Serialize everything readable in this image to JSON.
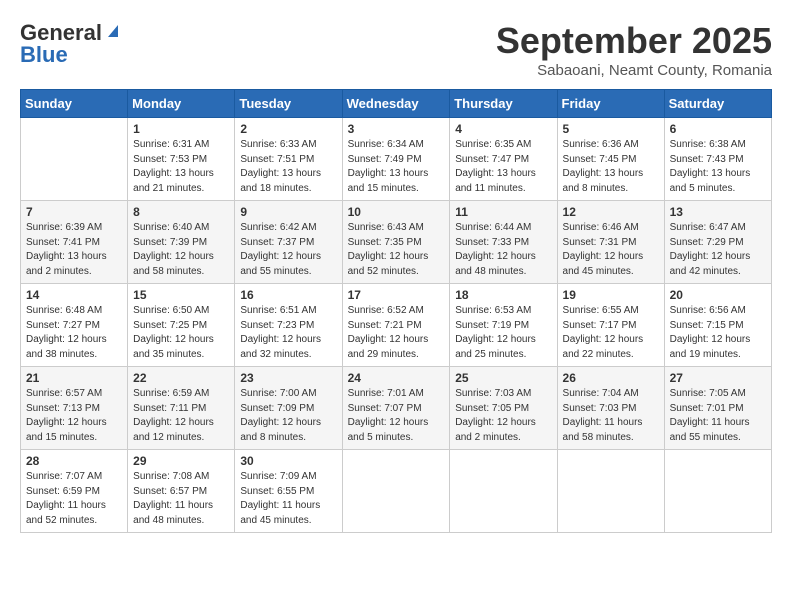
{
  "logo": {
    "general": "General",
    "blue": "Blue"
  },
  "header": {
    "month": "September 2025",
    "location": "Sabaoani, Neamt County, Romania"
  },
  "weekdays": [
    "Sunday",
    "Monday",
    "Tuesday",
    "Wednesday",
    "Thursday",
    "Friday",
    "Saturday"
  ],
  "weeks": [
    [
      {
        "day": "",
        "info": ""
      },
      {
        "day": "1",
        "info": "Sunrise: 6:31 AM\nSunset: 7:53 PM\nDaylight: 13 hours\nand 21 minutes."
      },
      {
        "day": "2",
        "info": "Sunrise: 6:33 AM\nSunset: 7:51 PM\nDaylight: 13 hours\nand 18 minutes."
      },
      {
        "day": "3",
        "info": "Sunrise: 6:34 AM\nSunset: 7:49 PM\nDaylight: 13 hours\nand 15 minutes."
      },
      {
        "day": "4",
        "info": "Sunrise: 6:35 AM\nSunset: 7:47 PM\nDaylight: 13 hours\nand 11 minutes."
      },
      {
        "day": "5",
        "info": "Sunrise: 6:36 AM\nSunset: 7:45 PM\nDaylight: 13 hours\nand 8 minutes."
      },
      {
        "day": "6",
        "info": "Sunrise: 6:38 AM\nSunset: 7:43 PM\nDaylight: 13 hours\nand 5 minutes."
      }
    ],
    [
      {
        "day": "7",
        "info": "Sunrise: 6:39 AM\nSunset: 7:41 PM\nDaylight: 13 hours\nand 2 minutes."
      },
      {
        "day": "8",
        "info": "Sunrise: 6:40 AM\nSunset: 7:39 PM\nDaylight: 12 hours\nand 58 minutes."
      },
      {
        "day": "9",
        "info": "Sunrise: 6:42 AM\nSunset: 7:37 PM\nDaylight: 12 hours\nand 55 minutes."
      },
      {
        "day": "10",
        "info": "Sunrise: 6:43 AM\nSunset: 7:35 PM\nDaylight: 12 hours\nand 52 minutes."
      },
      {
        "day": "11",
        "info": "Sunrise: 6:44 AM\nSunset: 7:33 PM\nDaylight: 12 hours\nand 48 minutes."
      },
      {
        "day": "12",
        "info": "Sunrise: 6:46 AM\nSunset: 7:31 PM\nDaylight: 12 hours\nand 45 minutes."
      },
      {
        "day": "13",
        "info": "Sunrise: 6:47 AM\nSunset: 7:29 PM\nDaylight: 12 hours\nand 42 minutes."
      }
    ],
    [
      {
        "day": "14",
        "info": "Sunrise: 6:48 AM\nSunset: 7:27 PM\nDaylight: 12 hours\nand 38 minutes."
      },
      {
        "day": "15",
        "info": "Sunrise: 6:50 AM\nSunset: 7:25 PM\nDaylight: 12 hours\nand 35 minutes."
      },
      {
        "day": "16",
        "info": "Sunrise: 6:51 AM\nSunset: 7:23 PM\nDaylight: 12 hours\nand 32 minutes."
      },
      {
        "day": "17",
        "info": "Sunrise: 6:52 AM\nSunset: 7:21 PM\nDaylight: 12 hours\nand 29 minutes."
      },
      {
        "day": "18",
        "info": "Sunrise: 6:53 AM\nSunset: 7:19 PM\nDaylight: 12 hours\nand 25 minutes."
      },
      {
        "day": "19",
        "info": "Sunrise: 6:55 AM\nSunset: 7:17 PM\nDaylight: 12 hours\nand 22 minutes."
      },
      {
        "day": "20",
        "info": "Sunrise: 6:56 AM\nSunset: 7:15 PM\nDaylight: 12 hours\nand 19 minutes."
      }
    ],
    [
      {
        "day": "21",
        "info": "Sunrise: 6:57 AM\nSunset: 7:13 PM\nDaylight: 12 hours\nand 15 minutes."
      },
      {
        "day": "22",
        "info": "Sunrise: 6:59 AM\nSunset: 7:11 PM\nDaylight: 12 hours\nand 12 minutes."
      },
      {
        "day": "23",
        "info": "Sunrise: 7:00 AM\nSunset: 7:09 PM\nDaylight: 12 hours\nand 8 minutes."
      },
      {
        "day": "24",
        "info": "Sunrise: 7:01 AM\nSunset: 7:07 PM\nDaylight: 12 hours\nand 5 minutes."
      },
      {
        "day": "25",
        "info": "Sunrise: 7:03 AM\nSunset: 7:05 PM\nDaylight: 12 hours\nand 2 minutes."
      },
      {
        "day": "26",
        "info": "Sunrise: 7:04 AM\nSunset: 7:03 PM\nDaylight: 11 hours\nand 58 minutes."
      },
      {
        "day": "27",
        "info": "Sunrise: 7:05 AM\nSunset: 7:01 PM\nDaylight: 11 hours\nand 55 minutes."
      }
    ],
    [
      {
        "day": "28",
        "info": "Sunrise: 7:07 AM\nSunset: 6:59 PM\nDaylight: 11 hours\nand 52 minutes."
      },
      {
        "day": "29",
        "info": "Sunrise: 7:08 AM\nSunset: 6:57 PM\nDaylight: 11 hours\nand 48 minutes."
      },
      {
        "day": "30",
        "info": "Sunrise: 7:09 AM\nSunset: 6:55 PM\nDaylight: 11 hours\nand 45 minutes."
      },
      {
        "day": "",
        "info": ""
      },
      {
        "day": "",
        "info": ""
      },
      {
        "day": "",
        "info": ""
      },
      {
        "day": "",
        "info": ""
      }
    ]
  ]
}
